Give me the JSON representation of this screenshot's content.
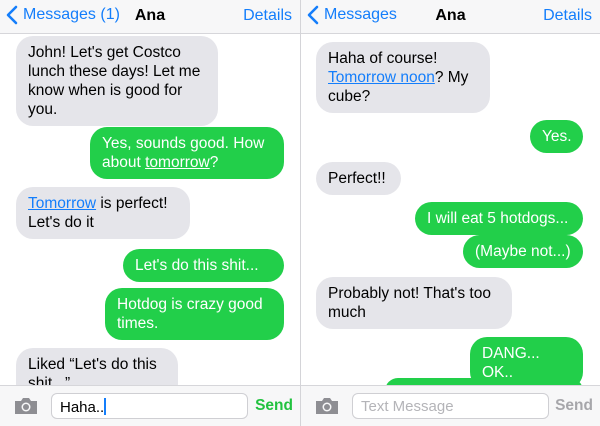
{
  "left": {
    "nav": {
      "back_label": "Messages (1)",
      "title": "Ana",
      "details_label": "Details"
    },
    "messages": [
      {
        "dir": "in",
        "text": "John! Let's get Costco lunch these days! Let me know when is good for you."
      },
      {
        "dir": "out",
        "before": "Yes, sounds good. How about ",
        "link": "tomorrow",
        "after": "?"
      },
      {
        "dir": "in",
        "link": "Tomorrow",
        "after": " is perfect! Let's do it"
      },
      {
        "dir": "out",
        "text": "Let's do this shit..."
      },
      {
        "dir": "out",
        "text": "Hotdog is crazy good times."
      },
      {
        "dir": "in",
        "text": "Liked “Let's do this shit...”"
      }
    ],
    "input": {
      "value": "Haha..",
      "placeholder": ""
    },
    "send_label": "Send"
  },
  "right": {
    "nav": {
      "back_label": "Messages",
      "title": "Ana",
      "details_label": "Details"
    },
    "messages": [
      {
        "dir": "in",
        "before": "Haha of course! ",
        "link": "Tomorrow noon",
        "after": "? My cube?"
      },
      {
        "dir": "out",
        "text": "Yes."
      },
      {
        "dir": "in",
        "text": "Perfect!!"
      },
      {
        "dir": "out",
        "text": "I will eat 5 hotdogs..."
      },
      {
        "dir": "out",
        "text": "(Maybe not...)"
      },
      {
        "dir": "in",
        "text": "Probably not! That's too much"
      },
      {
        "dir": "out",
        "text": "DANG... OK.."
      }
    ],
    "input": {
      "value": "",
      "placeholder": "Text Message"
    },
    "send_label": "Send"
  },
  "colors": {
    "accent": "#147efb",
    "outgoing": "#22cf4a",
    "incoming": "#e5e5ea"
  },
  "icons": {
    "back": "chevron-left-icon",
    "camera": "camera-icon"
  }
}
